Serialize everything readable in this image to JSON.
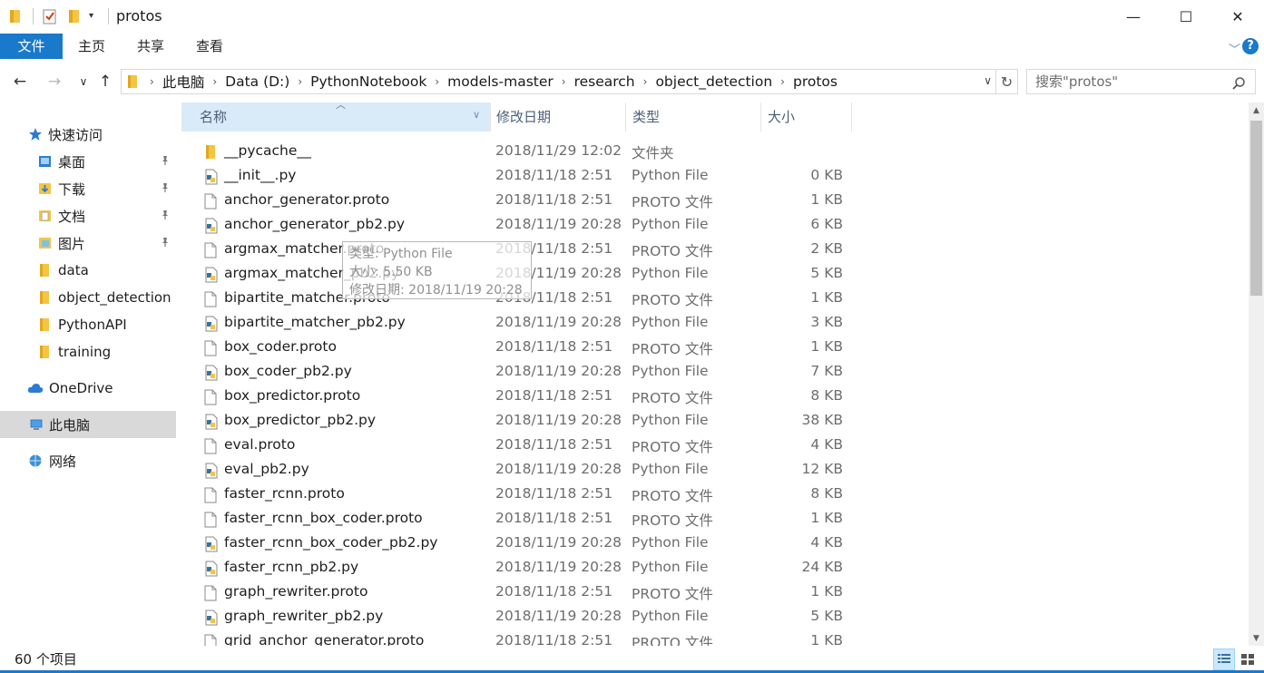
{
  "window": {
    "title": "protos",
    "minimize_glyph": "—",
    "maximize_glyph": "☐",
    "close_glyph": "✕"
  },
  "ribbon": {
    "tabs": [
      "文件",
      "主页",
      "共享",
      "查看"
    ],
    "expand_glyph": "﹀",
    "help_glyph": "?"
  },
  "nav": {
    "back_glyph": "←",
    "forward_glyph": "→",
    "recent_glyph": "∨",
    "up_glyph": "↑",
    "breadcrumbs": [
      "此电脑",
      "Data (D:)",
      "PythonNotebook",
      "models-master",
      "research",
      "object_detection",
      "protos"
    ],
    "dropdown_glyph": "∨",
    "refresh_glyph": "↻",
    "search_placeholder": "搜索\"protos\""
  },
  "sidebar": {
    "items": [
      {
        "label": "快速访问",
        "icon": "star-icon",
        "pinned": false
      },
      {
        "label": "桌面",
        "icon": "folder-icon",
        "pinned": true
      },
      {
        "label": "下载",
        "icon": "download-folder-icon",
        "pinned": true
      },
      {
        "label": "文档",
        "icon": "documents-folder-icon",
        "pinned": true
      },
      {
        "label": "图片",
        "icon": "pictures-folder-icon",
        "pinned": true
      },
      {
        "label": "data",
        "icon": "folder-icon",
        "pinned": false
      },
      {
        "label": "object_detection",
        "icon": "folder-icon",
        "pinned": false
      },
      {
        "label": "PythonAPI",
        "icon": "folder-icon",
        "pinned": false
      },
      {
        "label": "training",
        "icon": "folder-icon",
        "pinned": false
      },
      {
        "label": "OneDrive",
        "icon": "cloud-icon",
        "pinned": false
      },
      {
        "label": "此电脑",
        "icon": "computer-icon",
        "pinned": false,
        "selected": true
      },
      {
        "label": "网络",
        "icon": "network-icon",
        "pinned": false
      }
    ]
  },
  "columns": {
    "name": "名称",
    "date": "修改日期",
    "type": "类型",
    "size": "大小",
    "sort_glyph": "︿",
    "dropdown_glyph": "∨"
  },
  "files": [
    {
      "name": "__pycache__",
      "date": "2018/11/29 12:02",
      "type": "文件夹",
      "size": "",
      "kind": "folder"
    },
    {
      "name": "__init__.py",
      "date": "2018/11/18 2:51",
      "type": "Python File",
      "size": "0 KB",
      "kind": "python"
    },
    {
      "name": "anchor_generator.proto",
      "date": "2018/11/18 2:51",
      "type": "PROTO 文件",
      "size": "1 KB",
      "kind": "file"
    },
    {
      "name": "anchor_generator_pb2.py",
      "date": "2018/11/19 20:28",
      "type": "Python File",
      "size": "6 KB",
      "kind": "python"
    },
    {
      "name": "argmax_matcher.proto",
      "date": "2018/11/18 2:51",
      "type": "PROTO 文件",
      "size": "2 KB",
      "kind": "file"
    },
    {
      "name": "argmax_matcher_pb2.py",
      "date": "2018/11/19 20:28",
      "type": "Python File",
      "size": "5 KB",
      "kind": "python"
    },
    {
      "name": "bipartite_matcher.proto",
      "date": "2018/11/18 2:51",
      "type": "PROTO 文件",
      "size": "1 KB",
      "kind": "file"
    },
    {
      "name": "bipartite_matcher_pb2.py",
      "date": "2018/11/19 20:28",
      "type": "Python File",
      "size": "3 KB",
      "kind": "python"
    },
    {
      "name": "box_coder.proto",
      "date": "2018/11/18 2:51",
      "type": "PROTO 文件",
      "size": "1 KB",
      "kind": "file"
    },
    {
      "name": "box_coder_pb2.py",
      "date": "2018/11/19 20:28",
      "type": "Python File",
      "size": "7 KB",
      "kind": "python"
    },
    {
      "name": "box_predictor.proto",
      "date": "2018/11/18 2:51",
      "type": "PROTO 文件",
      "size": "8 KB",
      "kind": "file"
    },
    {
      "name": "box_predictor_pb2.py",
      "date": "2018/11/19 20:28",
      "type": "Python File",
      "size": "38 KB",
      "kind": "python"
    },
    {
      "name": "eval.proto",
      "date": "2018/11/18 2:51",
      "type": "PROTO 文件",
      "size": "4 KB",
      "kind": "file"
    },
    {
      "name": "eval_pb2.py",
      "date": "2018/11/19 20:28",
      "type": "Python File",
      "size": "12 KB",
      "kind": "python"
    },
    {
      "name": "faster_rcnn.proto",
      "date": "2018/11/18 2:51",
      "type": "PROTO 文件",
      "size": "8 KB",
      "kind": "file"
    },
    {
      "name": "faster_rcnn_box_coder.proto",
      "date": "2018/11/18 2:51",
      "type": "PROTO 文件",
      "size": "1 KB",
      "kind": "file"
    },
    {
      "name": "faster_rcnn_box_coder_pb2.py",
      "date": "2018/11/19 20:28",
      "type": "Python File",
      "size": "4 KB",
      "kind": "python"
    },
    {
      "name": "faster_rcnn_pb2.py",
      "date": "2018/11/19 20:28",
      "type": "Python File",
      "size": "24 KB",
      "kind": "python"
    },
    {
      "name": "graph_rewriter.proto",
      "date": "2018/11/18 2:51",
      "type": "PROTO 文件",
      "size": "1 KB",
      "kind": "file"
    },
    {
      "name": "graph_rewriter_pb2.py",
      "date": "2018/11/19 20:28",
      "type": "Python File",
      "size": "5 KB",
      "kind": "python"
    },
    {
      "name": "grid_anchor_generator.proto",
      "date": "2018/11/18 2:51",
      "type": "PROTO 文件",
      "size": "1 KB",
      "kind": "file"
    }
  ],
  "tooltip": {
    "line1": "类型: Python File",
    "line2": "大小: 5.50 KB",
    "line3": "修改日期: 2018/11/19 20:28"
  },
  "status": {
    "item_count": "60 个项目"
  },
  "colors": {
    "accent": "#1979ca",
    "sorted_header": "#d9ebf9",
    "selected_nav": "#d9d9d9",
    "folder_yellow": "#f4c542"
  }
}
